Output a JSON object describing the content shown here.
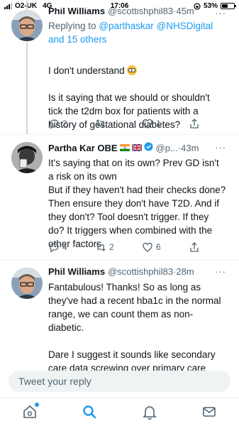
{
  "status_bar": {
    "carrier": "O2-UK",
    "network": "4G",
    "time": "17:06",
    "battery": "53%",
    "battery_level": 0.53
  },
  "tweets": [
    {
      "name": "Phil Williams",
      "handle": "@scottishphil83",
      "time": "45m",
      "replying_prefix": "Replying to ",
      "replying_mentions": "@parthaskar @NHSDigital",
      "replying_suffix": "and 15 others",
      "text_line1": "I don't understand",
      "text_rest": "Is it saying that we should or shouldn't tick the t2dm box for patients with a history of gestational diabetes?",
      "replies": "2",
      "retweets": "",
      "likes": "1"
    },
    {
      "name": "Partha Kar OBE",
      "handle": "@p...",
      "time": "43m",
      "text": "It's saying that on its own? Prev GD isn't a risk on its own\nBut if they haven't had their checks done? Then ensure they don't have T2D. And if they don't? Tool doesn't trigger. If they do? It triggers when combined with the other factors",
      "replies": "4",
      "retweets": "2",
      "likes": "6"
    },
    {
      "name": "Phil Williams",
      "handle": "@scottishphil83",
      "time": "28m",
      "text": "Fantabulous! Thanks! So as long as they've had a recent hba1c in the normal range, we can count them as non-diabetic.\n\nDare I suggest it sounds like secondary care data screwing over primary care"
    }
  ],
  "separator": " · ",
  "more_glyph": "···",
  "reply_bar": {
    "placeholder": "Tweet your reply"
  },
  "nav": {
    "items": [
      "home-icon",
      "search-icon",
      "notifications-icon",
      "messages-icon"
    ],
    "active": "search-icon"
  },
  "colors": {
    "accent": "#1d9bf0",
    "secondary_text": "#536471",
    "text": "#0f1419"
  }
}
